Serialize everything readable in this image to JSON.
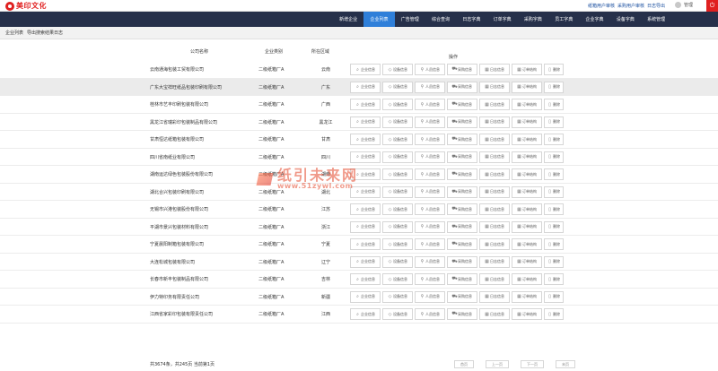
{
  "brand": {
    "logo_text": "美印文化",
    "accent": "#e02020",
    "nav_bg": "#26304a",
    "active_tab": "#2f7fd9"
  },
  "top_links": [
    "纸箱用户审核",
    "采购用户审核",
    "日志导出"
  ],
  "user": {
    "name": "管理"
  },
  "nav": {
    "tabs": [
      {
        "label": "新增企业",
        "active": false
      },
      {
        "label": "企业列表",
        "active": true
      },
      {
        "label": "广告管理",
        "active": false
      },
      {
        "label": "综合查询",
        "active": false
      },
      {
        "label": "日志字典",
        "active": false
      },
      {
        "label": "订单字典",
        "active": false
      },
      {
        "label": "采购字典",
        "active": false
      },
      {
        "label": "员工字典",
        "active": false
      },
      {
        "label": "企业字典",
        "active": false
      },
      {
        "label": "设备字典",
        "active": false
      },
      {
        "label": "系统管理",
        "active": false
      }
    ]
  },
  "subbar": {
    "items": [
      "企业列表",
      "导出搜索结果日志"
    ]
  },
  "table": {
    "headers": {
      "name": "公司名称",
      "type": "企业类别",
      "region": "所在区域",
      "actions": "操作"
    },
    "action_labels": [
      "企业信息",
      "设备信息",
      "人员信息",
      "采购信息",
      "日志信息",
      "订单结构",
      "删除"
    ],
    "action_icons": [
      "search-icon",
      "tag-icon",
      "person-icon",
      "cart-icon",
      "calendar-icon",
      "calendar-icon",
      "trash-icon"
    ],
    "rows": [
      {
        "name": "云南通海包装工贸有限公司",
        "type": "二级纸箱厂A",
        "region": "云南"
      },
      {
        "name": "广东大宝祥旺纸品包装印刷有限公司",
        "type": "二级纸箱厂A",
        "region": "广东"
      },
      {
        "name": "桂林市艺丰印刷包装有限公司",
        "type": "二级纸箱厂A",
        "region": "广西"
      },
      {
        "name": "黑龙江省瑞彩印包装制品有限公司",
        "type": "二级纸箱厂A",
        "region": "黑龙江"
      },
      {
        "name": "甘肃恒达纸箱包装有限公司",
        "type": "二级纸箱厂A",
        "region": "甘肃"
      },
      {
        "name": "四川省南纸业有限公司",
        "type": "二级纸箱厂A",
        "region": "四川"
      },
      {
        "name": "湖南运达绿色包装股份有限公司",
        "type": "二级纸箱厂A",
        "region": "湖南"
      },
      {
        "name": "湖北合兴包装印刷有限公司",
        "type": "二级纸箱厂A",
        "region": "湖北"
      },
      {
        "name": "无锡市兴港包装股份有限公司",
        "type": "二级纸箱厂A",
        "region": "江苏"
      },
      {
        "name": "平湖市景兴包装材料有限公司",
        "type": "二级纸箱厂A",
        "region": "浙江"
      },
      {
        "name": "宁夏晨阳制箱包装有限公司",
        "type": "二级纸箱厂A",
        "region": "宁夏"
      },
      {
        "name": "大连松城包装有限公司",
        "type": "二级纸箱厂A",
        "region": "辽宁"
      },
      {
        "name": "长春市新丰包装制品有限公司",
        "type": "二级纸箱厂A",
        "region": "吉林"
      },
      {
        "name": "伊力特印务有限责任公司",
        "type": "二级纸箱厂A",
        "region": "新疆"
      },
      {
        "name": "江西省家彩印包装有限责任公司",
        "type": "二级纸箱厂A",
        "region": "江西"
      }
    ],
    "highlighted_row": 1
  },
  "footer": {
    "count": "共3674条，共245页 当前第1页",
    "pager": [
      "首页",
      "上一页",
      "下一页",
      "末页"
    ]
  },
  "watermark": {
    "text": "纸引未来网",
    "url": "www.51zywl.com"
  }
}
